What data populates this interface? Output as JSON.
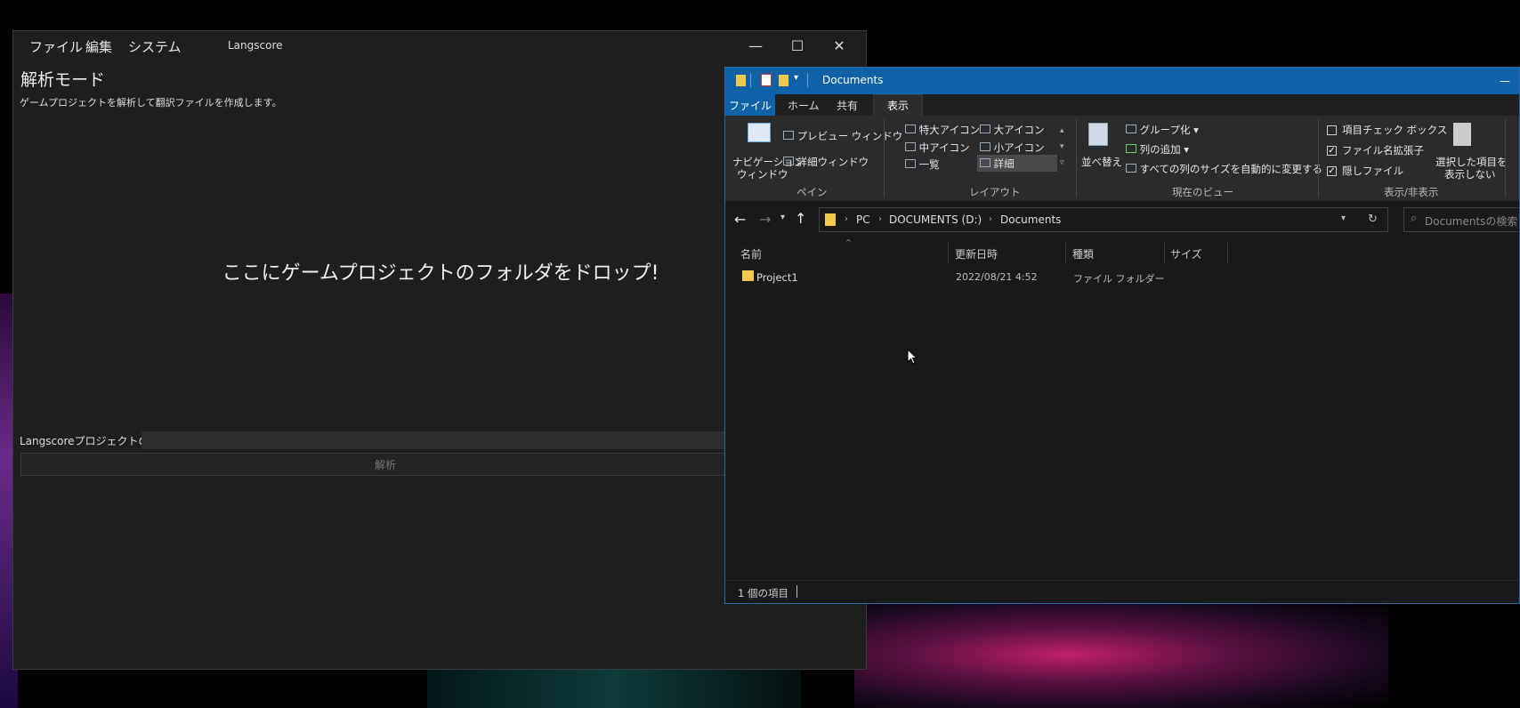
{
  "langscore": {
    "menu": [
      "ファイル",
      "編集",
      "システム"
    ],
    "app_title": "Langscore",
    "window_controls": {
      "minimize": "—",
      "maximize": "☐",
      "close": "✕"
    },
    "mode_title": "解析モード",
    "mode_description": "ゲームプロジェクトを解析して翻訳ファイルを作成します。",
    "drop_message": "ここにゲームプロジェクトのフォルダをドロップ!",
    "project_path_label": "Langscoreプロジェクトのパス",
    "project_path_value": "",
    "analyze_button": "解析"
  },
  "explorer": {
    "title": "Documents",
    "minimize": "—",
    "tabs": [
      "ファイル",
      "ホーム",
      "共有",
      "表示"
    ],
    "active_tab": "表示",
    "ribbon": {
      "pane": {
        "navigation_pane_1": "ナビゲーション",
        "navigation_pane_2": "ウィンドウ",
        "preview_pane": "プレビュー ウィンドウ",
        "details_pane": "詳細ウィンドウ",
        "group_label": "ペイン"
      },
      "layout": {
        "items": [
          "特大アイコン",
          "大アイコン",
          "中アイコン",
          "小アイコン",
          "一覧",
          "詳細"
        ],
        "selected": "詳細",
        "group_label": "レイアウト"
      },
      "current_view": {
        "sort_by": "並べ替え",
        "group_by": "グループ化",
        "add_columns": "列の追加",
        "size_all_columns": "すべての列のサイズを自動的に変更する",
        "group_label": "現在のビュー"
      },
      "show_hide": {
        "item_checkboxes": "項目チェック ボックス",
        "item_checkboxes_checked": false,
        "file_extensions": "ファイル名拡張子",
        "file_extensions_checked": true,
        "hidden_items": "隠しファイル",
        "hidden_items_checked": true,
        "hide_selected_1": "選択した項目を",
        "hide_selected_2": "表示しない",
        "group_label": "表示/非表示"
      }
    },
    "address": {
      "crumbs": [
        "PC",
        "DOCUMENTS (D:)",
        "Documents"
      ],
      "search_placeholder": "Documentsの検索"
    },
    "columns": [
      "名前",
      "更新日時",
      "種類",
      "サイズ"
    ],
    "rows": [
      {
        "name": "Project1",
        "modified": "2022/08/21 4:52",
        "type": "ファイル フォルダー",
        "size": ""
      }
    ],
    "status": "1 個の項目"
  }
}
